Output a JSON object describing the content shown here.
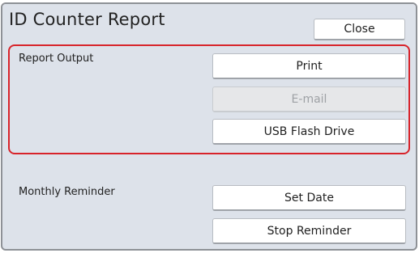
{
  "window": {
    "title": "ID Counter Report",
    "close_label": "Close"
  },
  "report_output": {
    "label": "Report Output",
    "buttons": [
      {
        "label": "Print",
        "enabled": true
      },
      {
        "label": "E-mail",
        "enabled": false
      },
      {
        "label": "USB Flash Drive",
        "enabled": true
      }
    ]
  },
  "monthly_reminder": {
    "label": "Monthly Reminder",
    "buttons": [
      {
        "label": "Set Date",
        "enabled": true
      },
      {
        "label": "Stop Reminder",
        "enabled": true
      }
    ]
  },
  "colors": {
    "background": "#dde2ea",
    "highlight_border": "#d8232a"
  }
}
